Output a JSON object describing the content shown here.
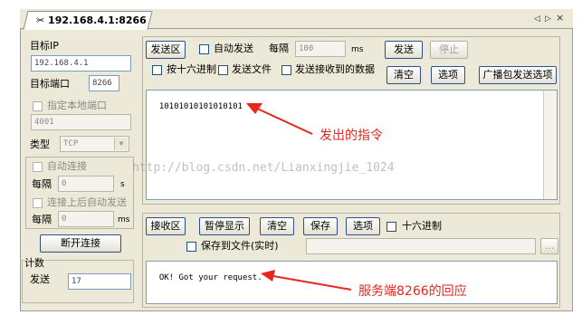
{
  "tab": {
    "title": "192.168.4.1:8266",
    "prev": "◁",
    "next": "▷",
    "close": "×"
  },
  "left": {
    "target_ip_label": "目标IP",
    "target_ip_value": "192.168.4.1",
    "target_port_label": "目标端口",
    "target_port_value": "8266",
    "local_port_label": "指定本地端口",
    "local_port_value": "4001",
    "type_label": "类型",
    "type_value": "TCP",
    "auto_connect_label": "自动连接",
    "interval_label": "每隔",
    "interval_value": "0",
    "interval_unit": "s",
    "auto_send_label": "连接上后自动发送",
    "interval2_label": "每隔",
    "interval2_value": "0",
    "interval2_unit": "ms",
    "disconnect_label": "断开连接",
    "count_label": "计数",
    "send_count_label": "发送",
    "send_count_value": "17"
  },
  "send": {
    "area_label": "发送区",
    "auto_send_label": "自动发送",
    "interval_label": "每隔",
    "interval_value": "100",
    "interval_unit": "ms",
    "send_button": "发送",
    "stop_button": "停止",
    "hex_label": "按十六进制",
    "send_file_label": "发送文件",
    "send_received_label": "发送接收到的数据",
    "clear_button": "清空",
    "options_button": "选项",
    "broadcast_button": "广播包发送选项",
    "content": "10101010101010101"
  },
  "recv": {
    "area_label": "接收区",
    "pause_button": "暂停显示",
    "clear_button": "清空",
    "save_button": "保存",
    "options_button": "选项",
    "hex_label": "十六进制",
    "save_to_file_label": "保存到文件(实时)",
    "browse_button": "...",
    "content": "OK! Got your request."
  },
  "annotations": {
    "sent_label": "发出的指令",
    "reply_label": "服务端8266的回应",
    "color": "#e8261e"
  },
  "watermark": "http://blog.csdn.net/Lianxingjie_1024"
}
